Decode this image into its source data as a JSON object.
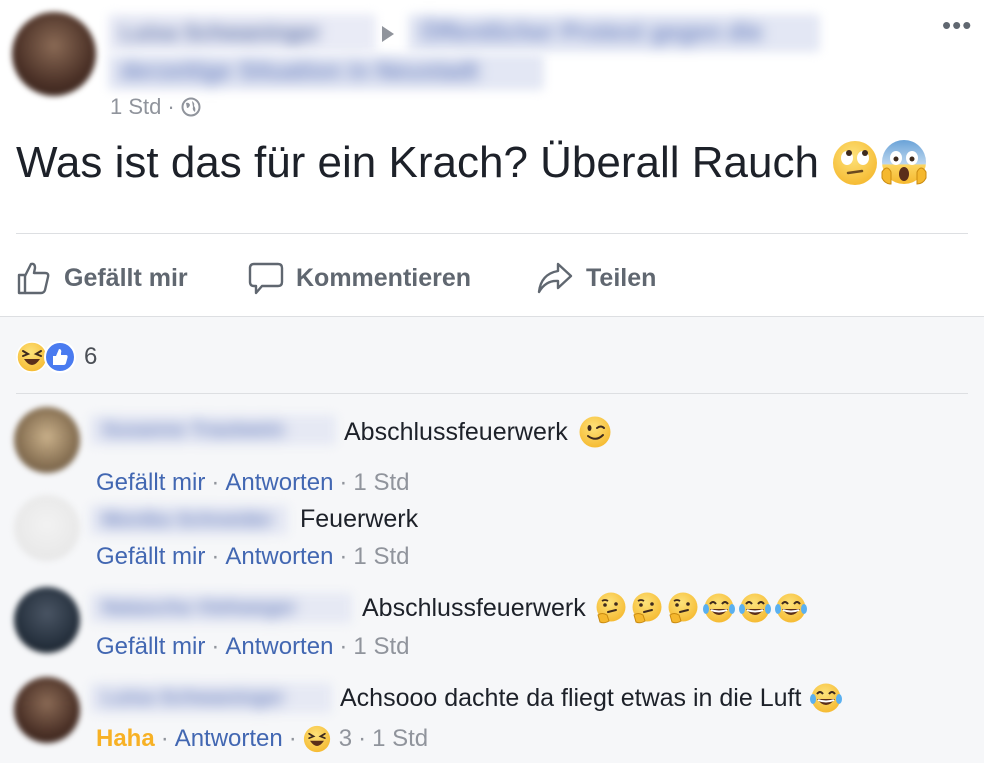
{
  "post": {
    "author_name": "Luisa Schwaninger",
    "group_name_line1": "Öffentlicher Protest gegen die",
    "group_name_line2": "derzeitige Situation in Neustadt",
    "time": "1 Std",
    "text": "Was ist das für ein Krach? Überall Rauch"
  },
  "actions": {
    "like": "Gefällt mir",
    "comment": "Kommentieren",
    "share": "Teilen"
  },
  "reactions": {
    "count": "6"
  },
  "comments": [
    {
      "author": "Susanne Trautwein",
      "text": "Abschlussfeuerwerk",
      "like": "Gefällt mir",
      "reply": "Antworten",
      "time": "1 Std"
    },
    {
      "author": "Monika Schneider",
      "text": "Feuerwerk",
      "like": "Gefällt mir",
      "reply": "Antworten",
      "time": "1 Std"
    },
    {
      "author": "Natascha Viehweger",
      "text": "Abschlussfeuerwerk",
      "like": "Gefällt mir",
      "reply": "Antworten",
      "time": "1 Std"
    },
    {
      "author": "Luisa Schwaninger",
      "text": "Achsooo dachte da fliegt etwas in die Luft",
      "like": "Haha",
      "reply": "Antworten",
      "reactions": "3",
      "time": "1 Std"
    }
  ],
  "colors": {
    "link": "#4267b2",
    "haha": "#f7b125",
    "meta": "#90949c",
    "panel": "#f6f7f9"
  }
}
